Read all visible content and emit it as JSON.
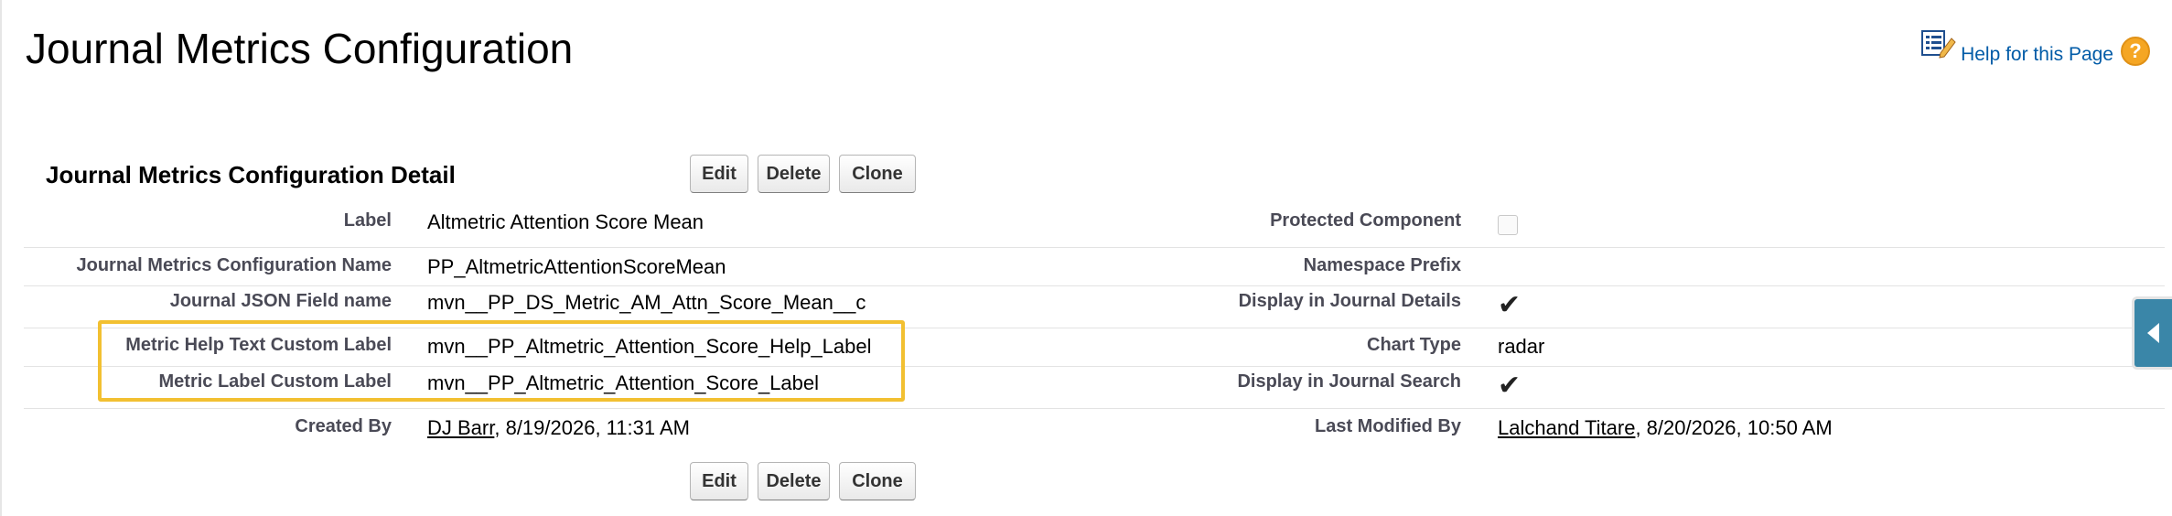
{
  "page": {
    "title": "Journal Metrics Configuration",
    "help_link": "Help for this Page"
  },
  "section": {
    "title": "Journal Metrics Configuration Detail"
  },
  "buttons": {
    "edit": "Edit",
    "delete": "Delete",
    "clone": "Clone"
  },
  "fields": {
    "label": {
      "label": "Label",
      "value": "Altmetric Attention Score Mean"
    },
    "protected_component": {
      "label": "Protected Component",
      "checked": false
    },
    "config_name": {
      "label": "Journal Metrics Configuration Name",
      "value": "PP_AltmetricAttentionScoreMean"
    },
    "namespace_prefix": {
      "label": "Namespace Prefix",
      "value": ""
    },
    "json_field_name": {
      "label": "Journal JSON Field name",
      "value": "mvn__PP_DS_Metric_AM_Attn_Score_Mean__c"
    },
    "display_in_details": {
      "label": "Display in Journal Details",
      "checked": true,
      "glyph": "✔"
    },
    "help_text_label": {
      "label": "Metric Help Text Custom Label",
      "value": "mvn__PP_Altmetric_Attention_Score_Help_Label"
    },
    "chart_type": {
      "label": "Chart Type",
      "value": "radar"
    },
    "metric_label": {
      "label": "Metric Label Custom Label",
      "value": "mvn__PP_Altmetric_Attention_Score_Label"
    },
    "display_in_search": {
      "label": "Display in Journal Search",
      "checked": true,
      "glyph": "✔"
    },
    "created_by": {
      "label": "Created By",
      "user": "DJ Barr",
      "date": ", 8/19/2026, 11:31 AM"
    },
    "last_modified_by": {
      "label": "Last Modified By",
      "user": "Lalchand Titare",
      "date": ", 8/20/2026, 10:50 AM"
    }
  },
  "colors": {
    "highlight": "#f2c031",
    "link": "#015ba7",
    "side_tab": "#3a86a8"
  },
  "icons": {
    "help_page": "help-page-icon",
    "help_question": "question-circle-icon",
    "side_tab": "collapse-arrow-icon"
  },
  "help_question_glyph": "?"
}
